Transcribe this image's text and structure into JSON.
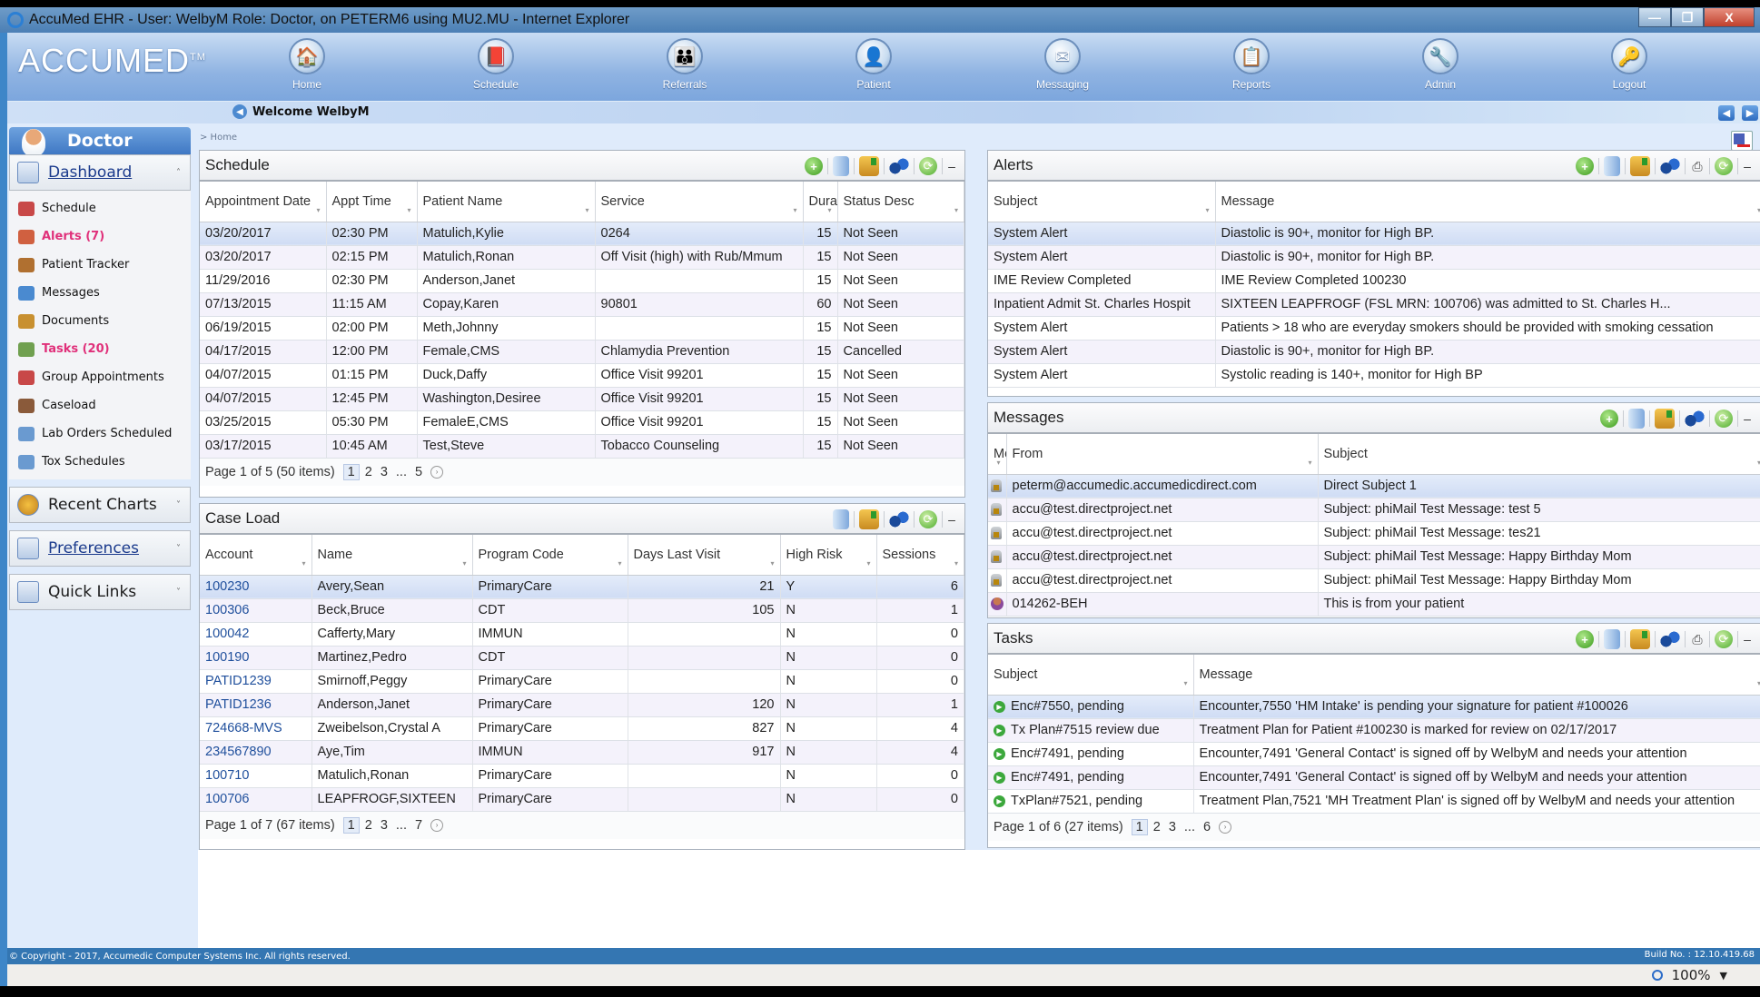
{
  "window": {
    "title": "AccuMed EHR - User: WelbyM Role: Doctor, on PETERM6 using MU2.MU - Internet Explorer",
    "buttons": {
      "minimize": "—",
      "restore": "❐",
      "close": "X"
    }
  },
  "header": {
    "logo": "ACCUMED",
    "logo_tm": "TM",
    "nav": [
      {
        "label": "Home",
        "icon": "home-icon",
        "glyph": "🏠"
      },
      {
        "label": "Schedule",
        "icon": "schedule-icon",
        "glyph": "📕"
      },
      {
        "label": "Referrals",
        "icon": "referrals-icon",
        "glyph": "👪"
      },
      {
        "label": "Patient",
        "icon": "patient-icon",
        "glyph": "👤"
      },
      {
        "label": "Messaging",
        "icon": "messaging-icon",
        "glyph": "✉"
      },
      {
        "label": "Reports",
        "icon": "reports-icon",
        "glyph": "📋"
      },
      {
        "label": "Admin",
        "icon": "admin-icon",
        "glyph": "🔧"
      },
      {
        "label": "Logout",
        "icon": "logout-icon",
        "glyph": "🔑"
      }
    ]
  },
  "welcome": {
    "text": "Welcome WelbyM",
    "back": "◀",
    "prev": "◀",
    "next": "▶"
  },
  "breadcrumb": "> Home",
  "sidebar": {
    "role": "Doctor",
    "dashboard": {
      "label": "Dashboard",
      "chevron": "˄",
      "items": [
        {
          "label": "Schedule",
          "color": "#c84848",
          "highlight": false
        },
        {
          "label": "Alerts (7)",
          "color": "#d06040",
          "highlight": true
        },
        {
          "label": "Patient Tracker",
          "color": "#b07030",
          "highlight": false
        },
        {
          "label": "Messages",
          "color": "#4a8ad0",
          "highlight": false
        },
        {
          "label": "Documents",
          "color": "#c89030",
          "highlight": false
        },
        {
          "label": "Tasks (20)",
          "color": "#70a050",
          "highlight": true
        },
        {
          "label": "Group Appointments",
          "color": "#c84848",
          "highlight": false
        },
        {
          "label": "Caseload",
          "color": "#8a5a3a",
          "highlight": false
        },
        {
          "label": "Lab Orders Scheduled",
          "color": "#6a9ad0",
          "highlight": false
        },
        {
          "label": "Tox Schedules",
          "color": "#6a9ad0",
          "highlight": false
        }
      ]
    },
    "recent_charts": {
      "label": "Recent Charts",
      "chevron": "˅"
    },
    "preferences": {
      "label": "Preferences",
      "chevron": "˅"
    },
    "quick_links": {
      "label": "Quick Links",
      "chevron": "˅"
    }
  },
  "toolbar": {
    "add": "+",
    "refresh": "⟳",
    "minimize": "–",
    "print": "⎙"
  },
  "schedule": {
    "title": "Schedule",
    "columns": [
      "Appointment Date",
      "Appt Time",
      "Patient Name",
      "Service",
      "Duration",
      "Status Desc"
    ],
    "rows": [
      [
        "03/20/2017",
        "02:30 PM",
        "Matulich,Kylie",
        "0264",
        "15",
        "Not Seen"
      ],
      [
        "03/20/2017",
        "02:15 PM",
        "Matulich,Ronan",
        "Off Visit (high) with Rub/Mmum",
        "15",
        "Not Seen"
      ],
      [
        "11/29/2016",
        "02:30 PM",
        "Anderson,Janet",
        "",
        "15",
        "Not Seen"
      ],
      [
        "07/13/2015",
        "11:15 AM",
        "Copay,Karen",
        "90801",
        "60",
        "Not Seen"
      ],
      [
        "06/19/2015",
        "02:00 PM",
        "Meth,Johnny",
        "",
        "15",
        "Not Seen"
      ],
      [
        "04/17/2015",
        "12:00 PM",
        "Female,CMS",
        "Chlamydia Prevention",
        "15",
        "Cancelled"
      ],
      [
        "04/07/2015",
        "01:15 PM",
        "Duck,Daffy",
        "Office Visit 99201",
        "15",
        "Not Seen"
      ],
      [
        "04/07/2015",
        "12:45 PM",
        "Washington,Desiree",
        "Office Visit 99201",
        "15",
        "Not Seen"
      ],
      [
        "03/25/2015",
        "05:30 PM",
        "FemaleE,CMS",
        "Office Visit 99201",
        "15",
        "Not Seen"
      ],
      [
        "03/17/2015",
        "10:45 AM",
        "Test,Steve",
        "Tobacco Counseling",
        "15",
        "Not Seen"
      ]
    ],
    "pager": {
      "summary": "Page 1 of 5 (50 items)",
      "pages": [
        "1",
        "2",
        "3",
        "...",
        "5"
      ],
      "next": "›"
    }
  },
  "caseload": {
    "title": "Case Load",
    "columns": [
      "Account",
      "Name",
      "Program Code",
      "Days Last Visit",
      "High Risk",
      "Sessions"
    ],
    "rows": [
      [
        "100230",
        "Avery,Sean",
        "PrimaryCare",
        "21",
        "Y",
        "6"
      ],
      [
        "100306",
        "Beck,Bruce",
        "CDT",
        "105",
        "N",
        "1"
      ],
      [
        "100042",
        "Cafferty,Mary",
        "IMMUN",
        "",
        "N",
        "0"
      ],
      [
        "100190",
        "Martinez,Pedro",
        "CDT",
        "",
        "N",
        "0"
      ],
      [
        "PATID1239",
        "Smirnoff,Peggy",
        "PrimaryCare",
        "",
        "N",
        "0"
      ],
      [
        "PATID1236",
        "Anderson,Janet",
        "PrimaryCare",
        "120",
        "N",
        "1"
      ],
      [
        "724668-MVS",
        "Zweibelson,Crystal A",
        "PrimaryCare",
        "827",
        "N",
        "4"
      ],
      [
        "234567890",
        "Aye,Tim",
        "IMMUN",
        "917",
        "N",
        "4"
      ],
      [
        "100710",
        "Matulich,Ronan",
        "PrimaryCare",
        "",
        "N",
        "0"
      ],
      [
        "100706",
        "LEAPFROGF,SIXTEEN",
        "PrimaryCare",
        "",
        "N",
        "0"
      ]
    ],
    "pager": {
      "summary": "Page 1 of 7 (67 items)",
      "pages": [
        "1",
        "2",
        "3",
        "...",
        "7"
      ],
      "next": "›"
    }
  },
  "alerts": {
    "title": "Alerts",
    "columns": [
      "Subject",
      "Message"
    ],
    "rows": [
      [
        "System Alert",
        "Diastolic is 90+, monitor for High BP."
      ],
      [
        "System Alert",
        "Diastolic is 90+, monitor for High BP."
      ],
      [
        "IME Review Completed",
        "IME Review Completed 100230"
      ],
      [
        "Inpatient Admit St. Charles Hospit",
        "SIXTEEN LEAPFROGF (FSL MRN: 100706) was admitted to St. Charles H..."
      ],
      [
        "System Alert",
        "Patients > 18 who are everyday smokers should be provided with smoking cessation"
      ],
      [
        "System Alert",
        "Diastolic is 90+, monitor for High BP."
      ],
      [
        "System Alert",
        "Systolic reading is 140+, monitor for High BP"
      ]
    ]
  },
  "messages": {
    "title": "Messages",
    "columns": [
      "Me",
      "From",
      "Subject"
    ],
    "rows": [
      {
        "icon": "message-icon",
        "from": "peterm@accumedic.accumedicdirect.com",
        "subject": "Direct Subject 1"
      },
      {
        "icon": "message-icon",
        "from": "accu@test.directproject.net",
        "subject": "Subject: phiMail Test Message: test 5"
      },
      {
        "icon": "message-icon",
        "from": "accu@test.directproject.net",
        "subject": "Subject: phiMail Test Message: tes21"
      },
      {
        "icon": "message-icon",
        "from": "accu@test.directproject.net",
        "subject": "Subject: phiMail Test Message: Happy Birthday Mom"
      },
      {
        "icon": "message-icon",
        "from": "accu@test.directproject.net",
        "subject": "Subject: phiMail Test Message: Happy Birthday Mom"
      },
      {
        "icon": "patient-message-icon",
        "from": "014262-BEH",
        "subject": "This is from your patient"
      }
    ]
  },
  "tasks": {
    "title": "Tasks",
    "columns": [
      "Subject",
      "Message"
    ],
    "rows": [
      [
        "Enc#7550, pending",
        "Encounter,7550 'HM Intake' is pending your signature for patient #100026"
      ],
      [
        "Tx Plan#7515 review due",
        "Treatment Plan for Patient #100230 is marked for review on 02/17/2017"
      ],
      [
        "Enc#7491, pending",
        "Encounter,7491 'General Contact' is signed off by WelbyM and needs your attention"
      ],
      [
        "Enc#7491, pending",
        "Encounter,7491 'General Contact' is signed off by WelbyM and needs your attention"
      ],
      [
        "TxPlan#7521, pending",
        "Treatment Plan,7521 'MH Treatment Plan' is signed off by WelbyM and needs your attention"
      ]
    ],
    "pager": {
      "summary": "Page 1 of 6 (27 items)",
      "pages": [
        "1",
        "2",
        "3",
        "...",
        "6"
      ],
      "next": "›"
    }
  },
  "footer": {
    "copyright": "© Copyright - 2017, Accumedic Computer Systems Inc. All rights reserved.",
    "build": "Build No. : 12.10.419.68"
  },
  "statusbar": {
    "zoom": "100%",
    "dropdown": "▼"
  }
}
